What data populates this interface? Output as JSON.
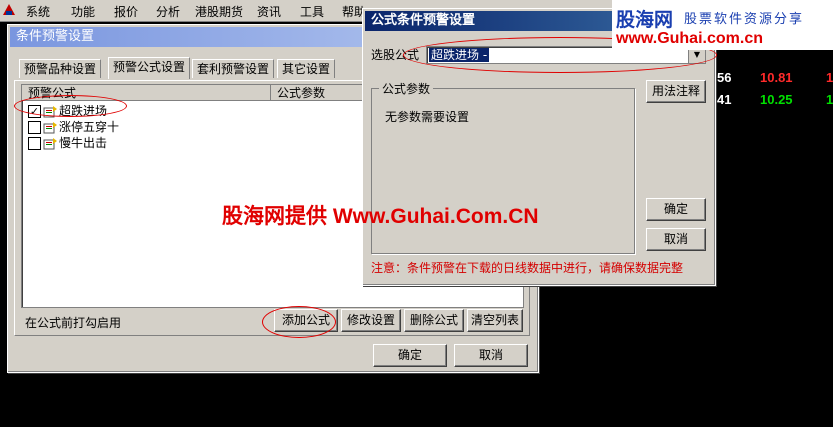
{
  "menubar": {
    "items": [
      "系统",
      "功能",
      "报价",
      "分析",
      "港股期货",
      "资讯",
      "工具",
      "帮助"
    ]
  },
  "background_quotes": {
    "row1": [
      "56",
      "10.81",
      "1"
    ],
    "row2": [
      "41",
      "10.25",
      "1"
    ]
  },
  "main_dialog": {
    "title": "条件预警设置",
    "tabs": [
      "预警品种设置",
      "预警公式设置",
      "套利预警设置",
      "其它设置"
    ],
    "active_tab": 1,
    "columns": [
      "预警公式",
      "公式参数"
    ],
    "formulas": [
      {
        "name": "超跌进场",
        "checked": true
      },
      {
        "name": "涨停五穿十",
        "checked": false
      },
      {
        "name": "慢牛出击",
        "checked": false
      }
    ],
    "hint": "在公式前打勾启用",
    "buttons": {
      "add": "添加公式",
      "edit": "修改设置",
      "delete": "删除公式",
      "clear": "清空列表",
      "ok": "确定",
      "cancel": "取消"
    }
  },
  "formula_dialog": {
    "title": "公式条件预警设置",
    "select_label": "选股公式",
    "select_value": "超跌进场 -",
    "group_label": "公式参数",
    "no_params": "无参数需要设置",
    "buttons": {
      "usage": "用法注释",
      "ok": "确定",
      "cancel": "取消"
    },
    "note": "注意：条件预警在下载的日线数据中进行，请确保数据完整"
  },
  "watermark": {
    "center": "股海网提供 Www.Guhai.Com.CN",
    "logo_cn": "股海网",
    "logo_slogan": "股票软件资源分享",
    "logo_url": "www.Guhai.com.cn"
  },
  "colors": {
    "red": "#ff2a2a",
    "green": "#00e000",
    "white": "#ffffff",
    "note_red": "#d40000",
    "logo_blue": "#1a3fb0",
    "logo_red": "#e00000"
  }
}
